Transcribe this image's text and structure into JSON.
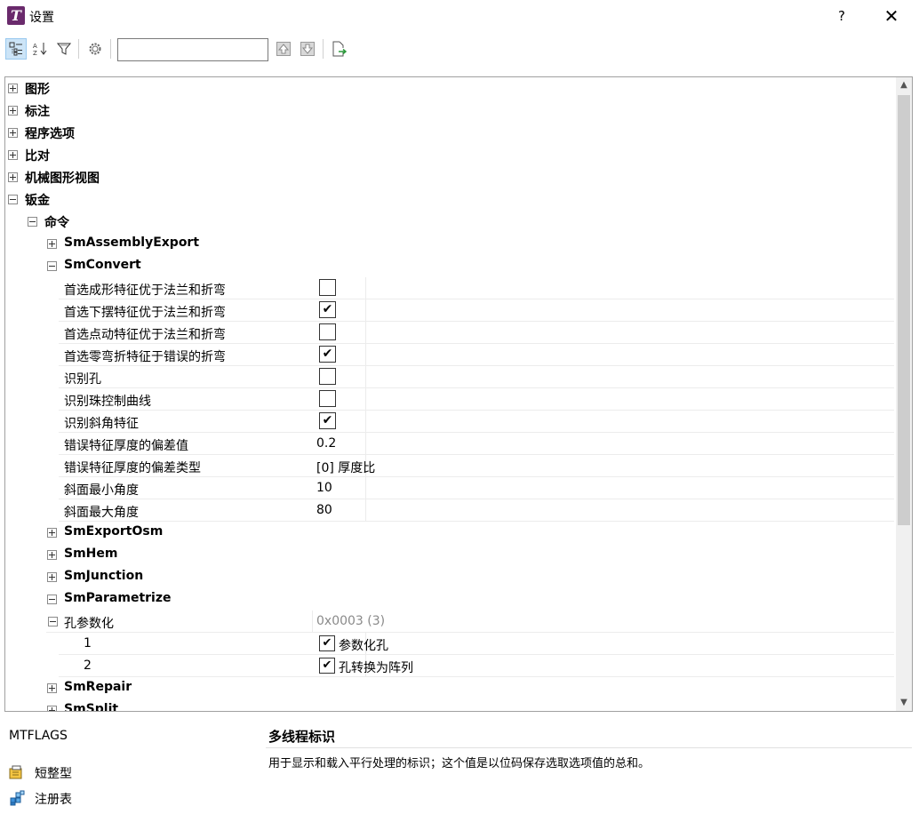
{
  "window": {
    "title": "设置",
    "help_label": "?",
    "close_label": "✕",
    "app_icon_letter": "T"
  },
  "toolbar": {
    "search_value": "",
    "buttons": [
      "categorized-view",
      "alphabetical-view",
      "filter",
      "settings",
      "move-up",
      "move-down",
      "export"
    ]
  },
  "tree": {
    "top_nodes": [
      {
        "label": "图形",
        "expanded": false
      },
      {
        "label": "标注",
        "expanded": false
      },
      {
        "label": "程序选项",
        "expanded": false
      },
      {
        "label": "比对",
        "expanded": false
      },
      {
        "label": "机械图形视图",
        "expanded": false
      },
      {
        "label": "钣金",
        "expanded": true
      }
    ],
    "commands_label": "命令",
    "sm_assembly_export": "SmAssemblyExport",
    "sm_convert": {
      "label": "SmConvert",
      "props": [
        {
          "name": "首选成形特征优于法兰和折弯",
          "type": "check",
          "checked": false
        },
        {
          "name": "首选下摆特征优于法兰和折弯",
          "type": "check",
          "checked": true
        },
        {
          "name": "首选点动特征优于法兰和折弯",
          "type": "check",
          "checked": false
        },
        {
          "name": "首选零弯折特征于错误的折弯",
          "type": "check",
          "checked": true
        },
        {
          "name": "识别孔",
          "type": "check",
          "checked": false
        },
        {
          "name": "识别珠控制曲线",
          "type": "check",
          "checked": false
        },
        {
          "name": "识别斜角特征",
          "type": "check",
          "checked": true
        },
        {
          "name": "错误特征厚度的偏差值",
          "type": "text",
          "value": "0.2"
        },
        {
          "name": "错误特征厚度的偏差类型",
          "type": "text",
          "value": "[0] 厚度比"
        },
        {
          "name": "斜面最小角度",
          "type": "text",
          "value": "10"
        },
        {
          "name": "斜面最大角度",
          "type": "text",
          "value": "80"
        }
      ]
    },
    "sm_export_osm": "SmExportOsm",
    "sm_hem": "SmHem",
    "sm_junction": "SmJunction",
    "sm_parametrize": {
      "label": "SmParametrize",
      "group_name": "孔参数化",
      "group_value": "0x0003 (3)",
      "items": [
        {
          "index": "1",
          "label": "参数化孔",
          "checked": true
        },
        {
          "index": "2",
          "label": "孔转换为阵列",
          "checked": true
        }
      ]
    },
    "sm_repair": "SmRepair",
    "sm_split": "SmSplit"
  },
  "description": {
    "key": "MTFLAGS",
    "title": "多线程标识",
    "text": "用于显示和载入平行处理的标识；这个值是以位码保存选取选项值的总和。",
    "type_label": "短整型",
    "storage_label": "注册表"
  },
  "colors": {
    "accent": "#6a2a6c",
    "selection": "#cce4f7"
  }
}
